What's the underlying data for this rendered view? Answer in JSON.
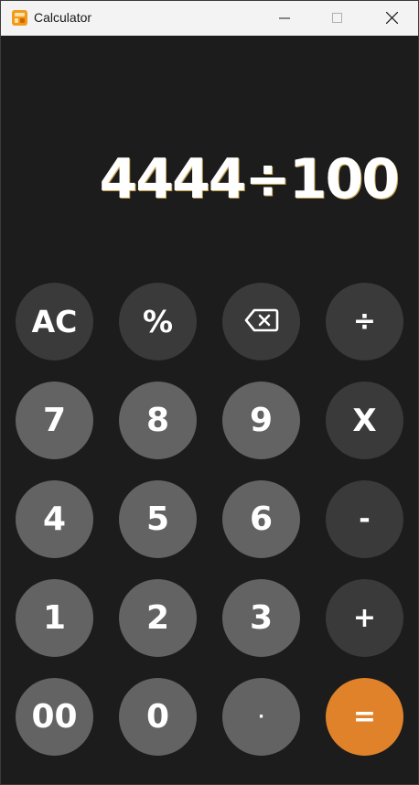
{
  "window": {
    "title": "Calculator"
  },
  "display": {
    "expression": "4444÷100"
  },
  "keys": {
    "ac": "AC",
    "percent": "%",
    "divide": "÷",
    "seven": "7",
    "eight": "8",
    "nine": "9",
    "multiply": "X",
    "four": "4",
    "five": "5",
    "six": "6",
    "minus": "-",
    "one": "1",
    "two": "2",
    "three": "3",
    "plus": "+",
    "double_zero": "00",
    "zero": "0",
    "dot": "·",
    "equals": "="
  },
  "colors": {
    "background": "#1c1c1c",
    "function_key": "#3a3a3a",
    "number_key": "#636363",
    "equals_key": "#e0822a"
  },
  "icons": {
    "app": "calculator-icon",
    "backspace": "backspace-icon"
  }
}
